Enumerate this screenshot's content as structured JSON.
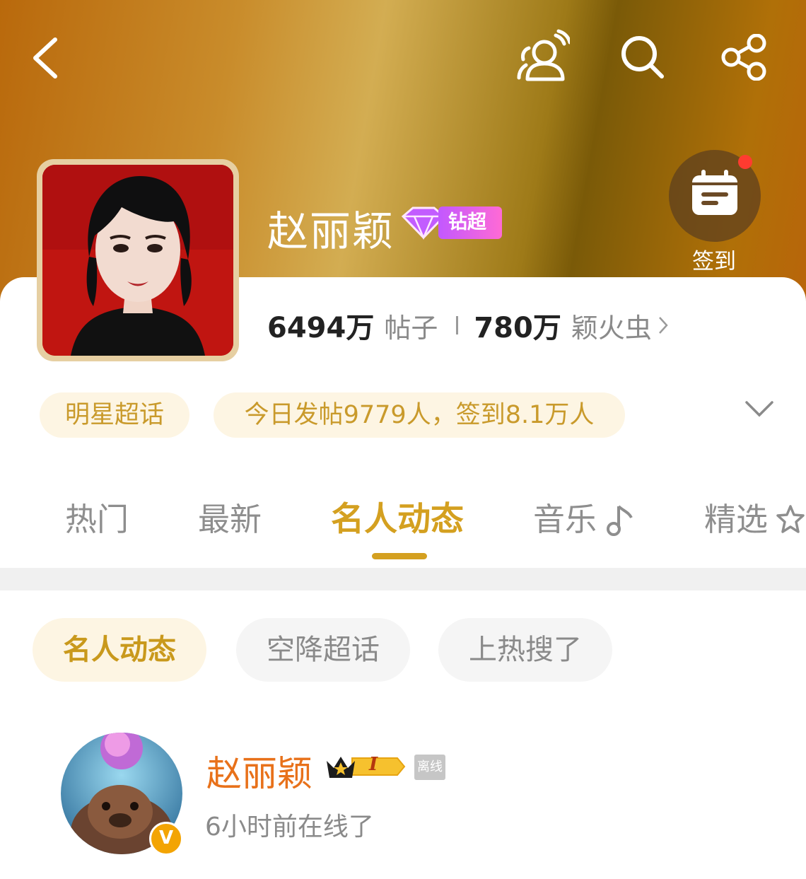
{
  "header": {
    "icons": [
      "back-icon",
      "friends-icon",
      "search-icon",
      "share-icon"
    ],
    "checkin": {
      "label": "签到",
      "icon": "calendar-icon",
      "has_notification_dot": true
    }
  },
  "topic": {
    "name": "赵丽颖",
    "level_badge": {
      "icon": "diamond-icon",
      "label": "钻超"
    },
    "posts_count": "6494万",
    "posts_label": "帖子",
    "fans_count": "780万",
    "fans_label": "颖火虫"
  },
  "info": {
    "category": "明星超话",
    "today_stats": "今日发帖9779人，签到8.1万人"
  },
  "tabs": {
    "items": [
      {
        "label": "热门",
        "active": false
      },
      {
        "label": "最新",
        "active": false
      },
      {
        "label": "名人动态",
        "active": true
      },
      {
        "label": "音乐",
        "active": false,
        "icon": "music-note-icon"
      },
      {
        "label": "精选",
        "active": false,
        "icon": "sparkle-icon"
      }
    ]
  },
  "filters": {
    "chips": [
      {
        "label": "名人动态",
        "active": true
      },
      {
        "label": "空降超话",
        "active": false
      },
      {
        "label": "上热搜了",
        "active": false
      }
    ]
  },
  "celebrity": {
    "name": "赵丽颖",
    "badge_level": "I",
    "verified": "V",
    "status_tag": "离线",
    "last_seen": "6小时前在线了"
  },
  "colors": {
    "accent": "#d4a020",
    "pill_bg": "#fdf5e3",
    "name_orange": "#e8711a",
    "header_gold": "#d3ad52"
  }
}
